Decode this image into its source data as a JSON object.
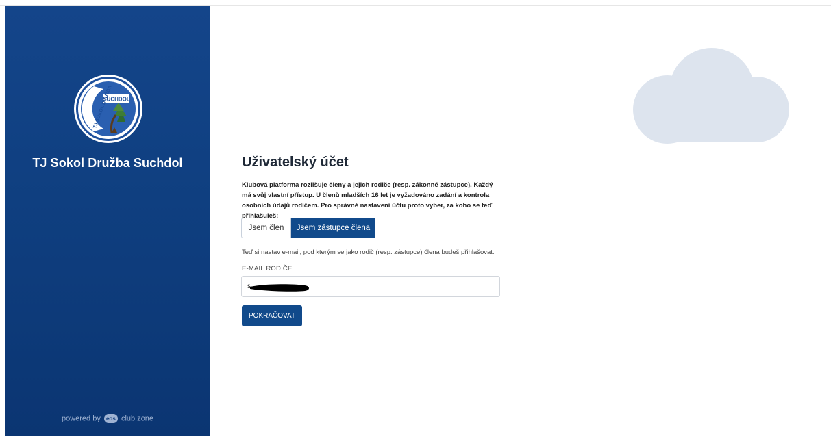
{
  "sidebar": {
    "club_name": "TJ Sokol Družba Suchdol",
    "logo_text_top": "SUCHDOL",
    "logo_text_arc": "TJ SOKOL DRUŽBA",
    "powered_prefix": "powered by",
    "powered_badge": "eos",
    "powered_suffix": "club zone"
  },
  "main": {
    "title": "Uživatelský účet",
    "description": "Klubová platforma rozlišuje členy a jejich rodiče (resp. zákonné zástupce). Každý má svůj vlastní přístup. U členů mladších 16 let je vyžadováno zadání a kontrola osobních údajů rodičem. Pro správné nastavení účtu proto vyber, za koho se teď přihlašuješ:",
    "segment": {
      "options": [
        "Jsem člen",
        "Jsem zástupce člena"
      ],
      "selected": "Jsem zástupce člena"
    },
    "hint": "Teď si nastav e-mail, pod kterým se jako rodič (resp. zástupce) člena budeš přihlašovat:",
    "email_label": "E-MAIL RODIČE",
    "email_value": "s",
    "continue_label": "POKRAČOVAT"
  },
  "colors": {
    "sidebar": "#0f3f80",
    "primary": "#114a8b",
    "cloud": "#dde4ee"
  }
}
